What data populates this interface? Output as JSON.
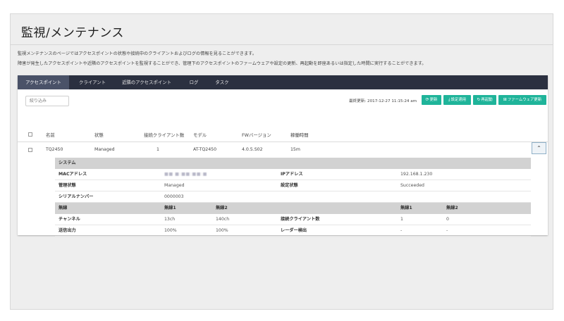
{
  "page": {
    "title": "監視/メンテナンス",
    "description_1": "監視メンテナンスのページではアクセスポイントの状態や接続中のクライアントおよびログの情報を見ることができます。",
    "description_2": "障害が発生したアクセスポイントや近隣のアクセスポイントを監視することができ、管理下のアクセスポイントのファームウェアや設定の更新、再起動を即座あるいは指定した時間に実行することができます。"
  },
  "tabs": [
    {
      "label": "アクセスポイント",
      "active": true
    },
    {
      "label": "クライアント",
      "active": false
    },
    {
      "label": "近隣のアクセスポイント",
      "active": false
    },
    {
      "label": "ログ",
      "active": false
    },
    {
      "label": "タスク",
      "active": false
    }
  ],
  "toolbar": {
    "filter_placeholder": "絞り込み",
    "last_updated": "最終更新: 2017-12-27 11:15:24 am",
    "buttons": [
      {
        "icon": "refresh-icon",
        "label": "更新"
      },
      {
        "icon": "apply-settings-icon",
        "label": "設定適用"
      },
      {
        "icon": "restart-icon",
        "label": "再起動"
      },
      {
        "icon": "firmware-icon",
        "label": "ファームウェア更新"
      }
    ]
  },
  "table": {
    "headers": [
      "名前",
      "状態",
      "接続クライアント数",
      "モデル",
      "FWバージョン",
      "稼働時間"
    ],
    "rows": [
      {
        "name": "TQ2450",
        "status": "Managed",
        "clients": "1",
        "model": "AT-TQ2450",
        "fw": "4.0.5.S02",
        "uptime": "15m"
      }
    ],
    "expand_icon": "chevron-up-icon"
  },
  "detail": {
    "system_header": "システム",
    "mac_label": "MACアドレス",
    "mac_value": "■■ ■:■■:■■:■",
    "ip_label": "IPアドレス",
    "ip_value": "192.168.1.230",
    "mgmt_label": "管理状態",
    "mgmt_value": "Managed",
    "config_label": "設定状態",
    "config_value": "Succeeded",
    "serial_label": "シリアルナンバー",
    "serial_value": "0000003",
    "radio_header": "無線",
    "radio1": "無線1",
    "radio2": "無線2",
    "radio1b": "無線1",
    "radio2b": "無線2",
    "channel_label": "チャンネル",
    "channel_r1": "13ch",
    "channel_r2": "140ch",
    "clients_label": "接続クライアント数",
    "clients_r1": "1",
    "clients_r2": "0",
    "power_label": "送信出力",
    "power_r1": "100%",
    "power_r2": "100%",
    "radar_label": "レーダー検出",
    "radar_r1": "-",
    "radar_r2": "-"
  },
  "colors": {
    "tab_bar": "#2b3040",
    "button": "#1fb49a",
    "background": "#eeeeee"
  }
}
